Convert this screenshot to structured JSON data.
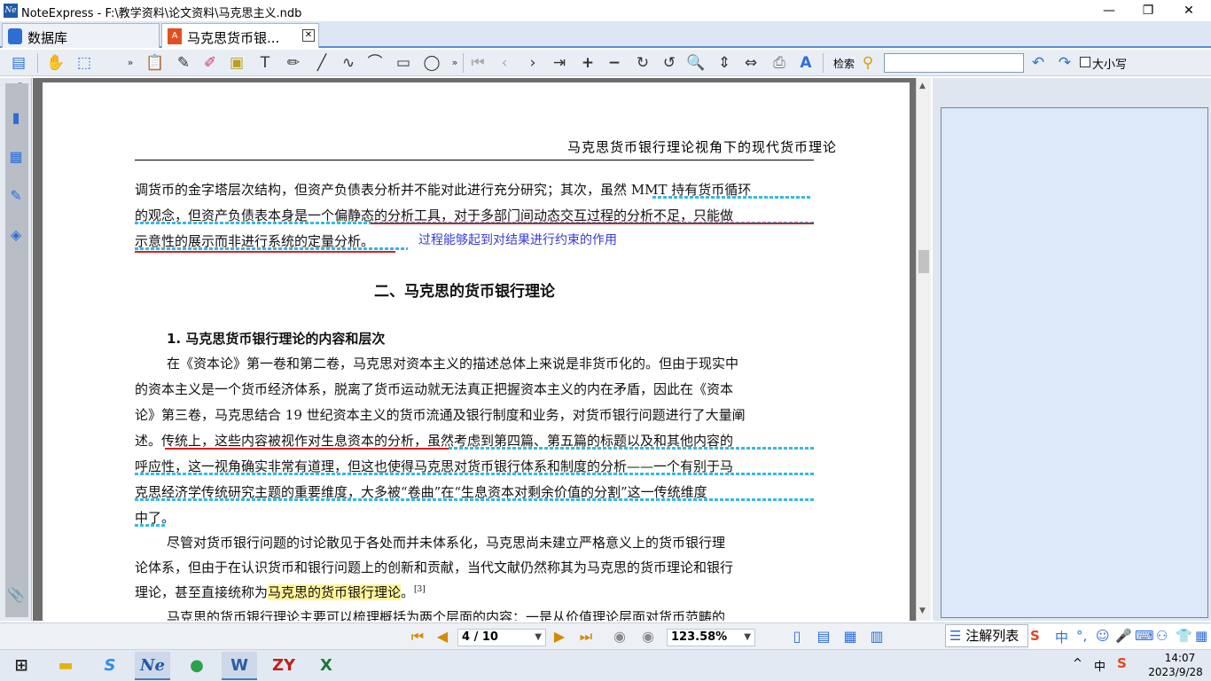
{
  "window": {
    "title": "NoteExpress - F:\\教学资料\\论文资料\\马克思主义.ndb",
    "logo_text": "Ne",
    "minimize": "—",
    "maximize": "❐",
    "close": "✕"
  },
  "tabs": [
    {
      "label": "数据库",
      "icon": "database-icon"
    },
    {
      "label": "马克思货币银...",
      "icon": "pdf-icon",
      "close": "✕"
    }
  ],
  "toolbar": {
    "search_label": "检索",
    "search_value": "",
    "case_label": "大小写"
  },
  "document": {
    "running_header": "马克思货币银行理论视角下的现代货币理论",
    "line1": "调货币的金字塔层次结构，但资产负债表分析并不能对此进行充分研究；其次，虽然 MMT 持有货币循环",
    "line2": "的观念，但资产负债表本身是一个偏静态的分析工具，对于多部门间动态交互过程的分析不足，只能做",
    "line3": "示意性的展示而非进行系统的定量分析。",
    "annotation": "过程能够起到对结果进行约束的作用",
    "section_heading": "二、马克思的货币银行理论",
    "subsection_heading": "1. 马克思货币银行理论的内容和层次",
    "p2_l1": "在《资本论》第一卷和第二卷，马克思对资本主义的描述总体上来说是非货币化的。但由于现实中",
    "p2_l2": "的资本主义是一个货币经济体系，脱离了货币运动就无法真正把握资本主义的内在矛盾，因此在《资本",
    "p2_l3": "论》第三卷，马克思结合 19 世纪资本主义的货币流通及银行制度和业务，对货币银行问题进行了大量阐",
    "p2_l4": "述。传统上，这些内容被视作对生息资本的分析，虽然考虑到第四篇、第五篇的标题以及和其他内容的",
    "p2_l5": "呼应性，这一视角确实非常有道理，但这也使得马克思对货币银行体系和制度的分析——一个有别于马",
    "p2_l6": "克思经济学传统研究主题的重要维度，大多被“卷曲”在“生息资本对剩余价值的分割”这一传统维度",
    "p2_l7": "中了。",
    "p3_l1": "尽管对货币银行问题的讨论散见于各处而并未体系化，马克思尚未建立严格意义上的货币银行理",
    "p3_l2": "论体系，但由于在认识货币和银行问题上的创新和贡献，当代文献仍然称其为马克思的货币理论和银行",
    "p3_l3_pre": "理论，甚至直接统称为",
    "p3_l3_hl": "马克思的货币银行理论",
    "p3_l3_post": "。",
    "p3_cite": "[3]",
    "p4_l1": "马克思的货币银行理论主要可以梳理概括为两个层面的内容：一是从价值理论层面对货币范畴的"
  },
  "statusbar": {
    "page_indicator": "4 / 10",
    "zoom": "123.58%",
    "notes_tab": "注解列表"
  },
  "ime": {
    "lang": "中"
  },
  "tray": {
    "ime_indicator": "中",
    "time": "14:07",
    "date": "2023/9/28"
  },
  "taskbar": [
    {
      "name": "start-button",
      "glyph": "⊞"
    },
    {
      "name": "file-explorer-icon",
      "glyph": "▬"
    },
    {
      "name": "sogou-browser-icon",
      "glyph": "S"
    },
    {
      "name": "noteexpress-icon",
      "glyph": "Ne"
    },
    {
      "name": "evernote-icon",
      "glyph": "●"
    },
    {
      "name": "word-icon",
      "glyph": "W"
    },
    {
      "name": "zy-app-icon",
      "glyph": "ZY"
    },
    {
      "name": "excel-icon",
      "glyph": "X"
    }
  ]
}
